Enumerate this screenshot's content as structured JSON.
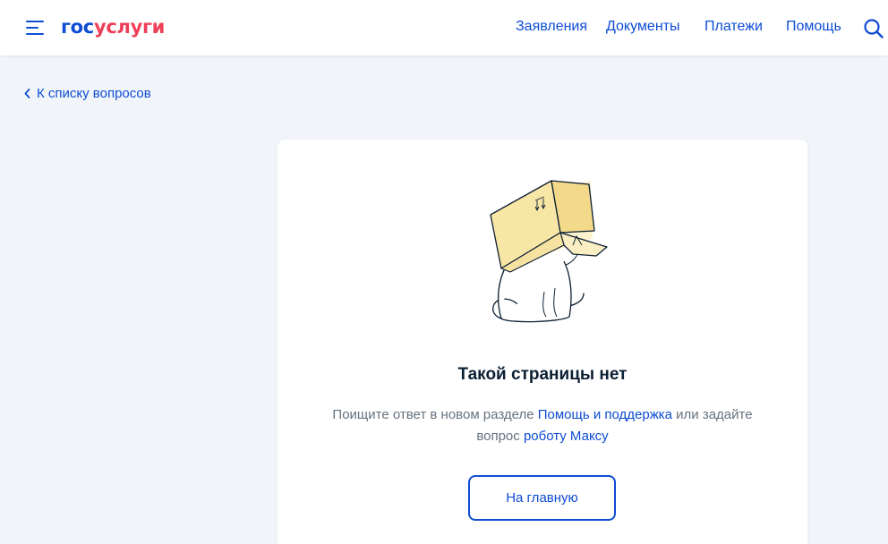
{
  "header": {
    "logo_part1": "гос",
    "logo_part2": "услуги",
    "nav": [
      "Заявления",
      "Документы",
      "Платежи",
      "Помощь"
    ]
  },
  "back_link": "К списку вопросов",
  "error": {
    "title": "Такой страницы нет",
    "desc_prefix": "Поищите ответ в новом разделе ",
    "help_link": "Помощь и поддержка",
    "desc_middle": " или задайте вопрос ",
    "robot_link": "роботу Максу",
    "button": "На главную"
  },
  "colors": {
    "brand_blue": "#0d4cd3",
    "brand_red": "#ee3f58",
    "background": "#f1f5fa",
    "text_secondary": "#66727f"
  },
  "icons": [
    "menu-icon",
    "search-icon",
    "chevron-left-icon",
    "cat-in-box-illustration"
  ]
}
